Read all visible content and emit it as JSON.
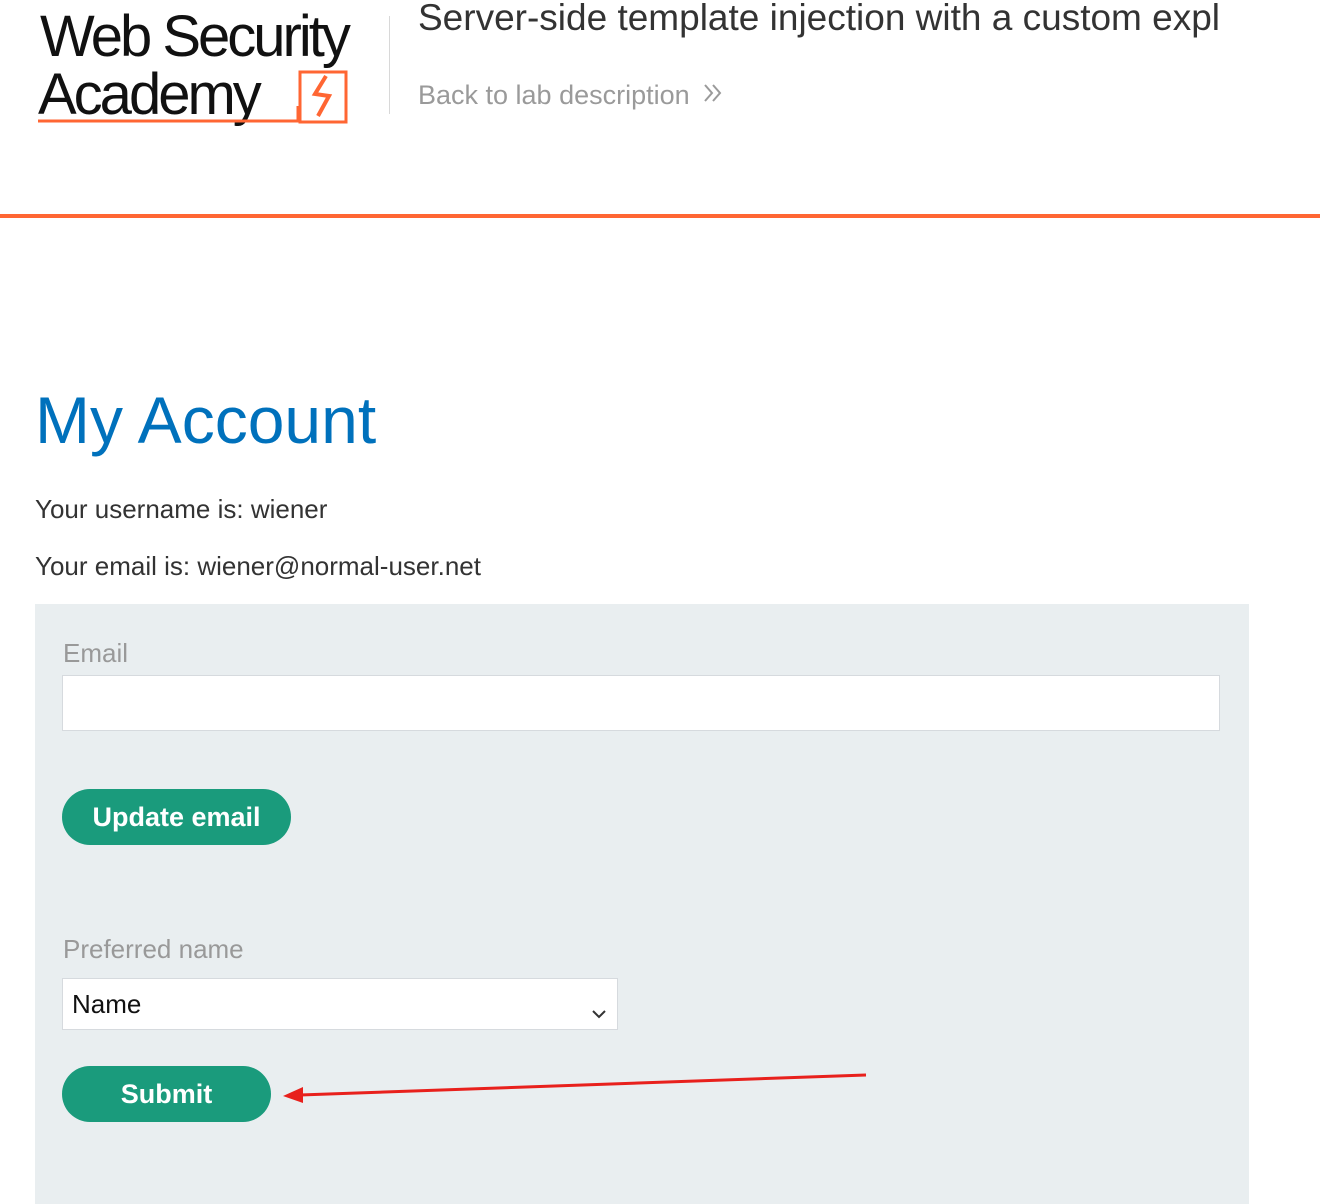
{
  "header": {
    "logo_line1": "Web Security",
    "logo_line2": "Academy",
    "lab_title": "Server-side template injection with a custom expl",
    "back_link_label": "Back to lab description"
  },
  "main": {
    "title": "My Account",
    "username_line": "Your username is: wiener",
    "email_line": "Your email is: wiener@normal-user.net"
  },
  "form": {
    "email_label": "Email",
    "email_value": "",
    "update_button_label": "Update email",
    "preferred_name_label": "Preferred name",
    "preferred_name_selected": "Name",
    "submit_button_label": "Submit"
  },
  "colors": {
    "accent_orange": "#ff6633",
    "title_blue": "#0071bc",
    "button_green": "#1a9b7c",
    "panel_bg": "#e9eef0",
    "annotation_red": "#e8201c"
  },
  "icons": {
    "logo_mark": "lightning-bolt-icon",
    "back_chevron": "double-chevron-right-icon",
    "select_caret": "chevron-down-icon"
  }
}
